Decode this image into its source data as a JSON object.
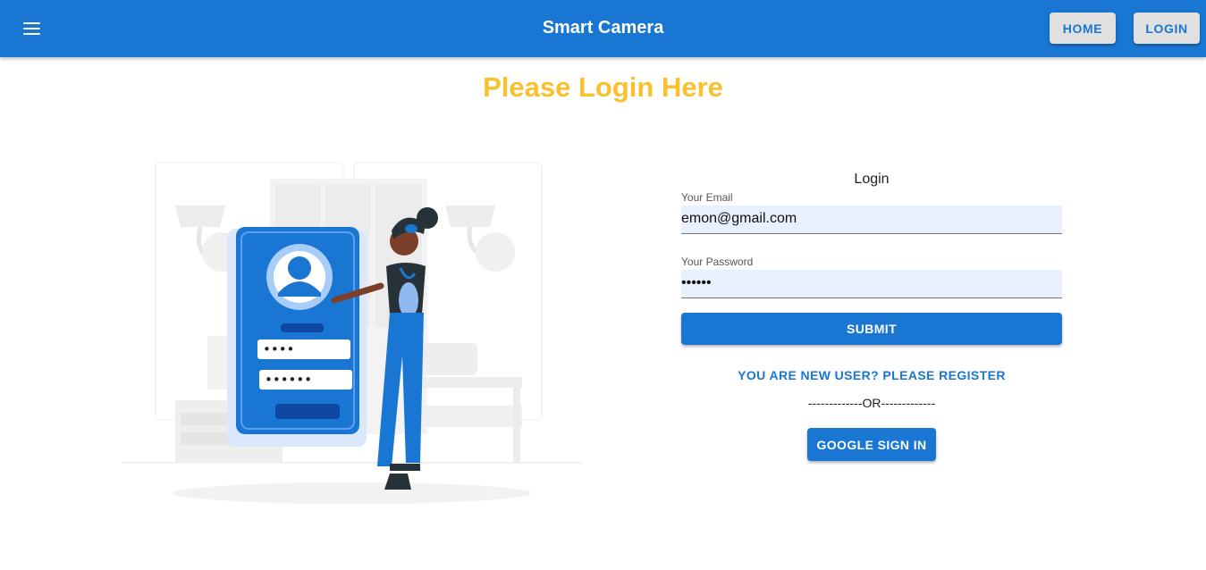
{
  "appbar": {
    "title": "Smart Camera",
    "menu_icon": "menu-icon",
    "nav": {
      "home_label": "HOME",
      "login_label": "LOGIN"
    }
  },
  "page": {
    "heading": "Please Login Here"
  },
  "login_form": {
    "title": "Login",
    "email": {
      "label": "Your Email",
      "value": "emon@gmail.com"
    },
    "password": {
      "label": "Your Password",
      "value": "••••••"
    },
    "submit_label": "SUBMIT",
    "register_link": "YOU ARE NEW USER? PLEASE REGISTER",
    "or_divider": "-------------OR-------------",
    "google_label": "GOOGLE SIGN IN"
  },
  "illustration": {
    "icon": "mobile-login-illustration",
    "pin_dots": "••••",
    "password_dots": "••••••"
  },
  "colors": {
    "primary": "#1976d2",
    "heading": "#fbc02d",
    "nav_button_bg": "#e0e0e0",
    "input_bg": "#e8f0fe"
  }
}
